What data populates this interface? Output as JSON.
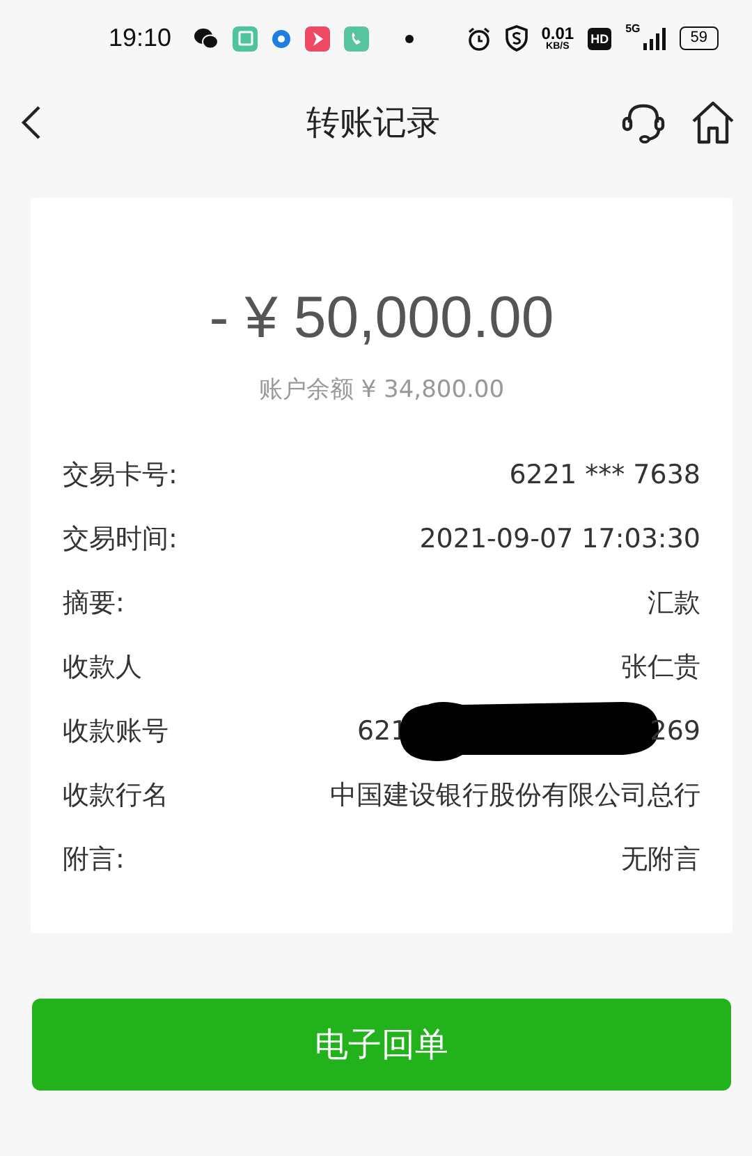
{
  "status_bar": {
    "time": "19:10",
    "net_speed": "0.01",
    "net_unit": "KB/S",
    "hd": "HD",
    "network": "5G",
    "battery": "59"
  },
  "header": {
    "title": "转账记录"
  },
  "amount": "- ¥ 50,000.00",
  "balance": "账户余额 ¥ 34,800.00",
  "rows": [
    {
      "kind": "text",
      "label": "交易卡号:",
      "value": "6221 *** 7638"
    },
    {
      "kind": "text",
      "label": "交易时间:",
      "value": "2021-09-07 17:03:30"
    },
    {
      "kind": "text",
      "label": "摘要:",
      "value": "汇款"
    },
    {
      "kind": "text",
      "label": "收款人",
      "value": "张仁贵"
    },
    {
      "kind": "redacted",
      "label": "收款账号",
      "value_start": "621",
      "value_end": "269"
    },
    {
      "kind": "text",
      "label": "收款行名",
      "value": "中国建设银行股份有限公司总行"
    },
    {
      "kind": "text",
      "label": "附言:",
      "value": "无附言"
    }
  ],
  "button": "电子回单"
}
